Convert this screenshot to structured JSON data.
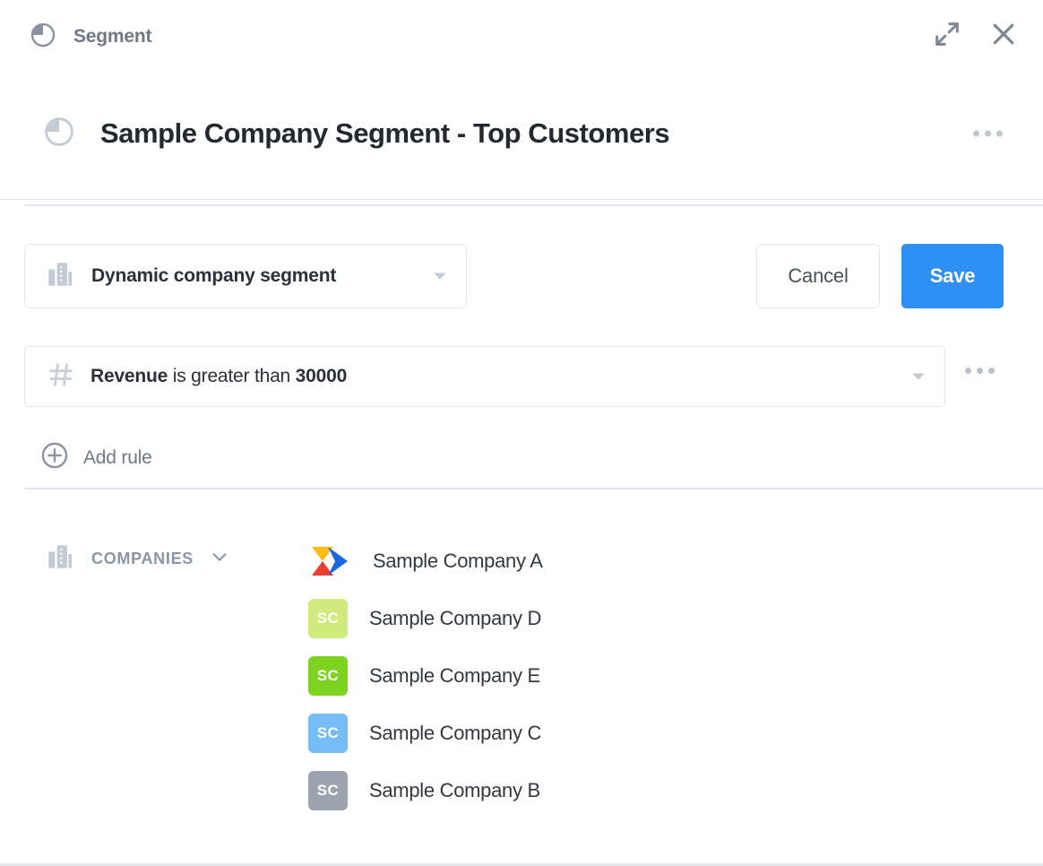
{
  "topbar": {
    "title": "Segment",
    "icon": "pie-chart-icon",
    "expand_icon": "expand-diagonal-icon",
    "close_icon": "close-icon"
  },
  "header": {
    "icon": "pie-chart-icon",
    "title": "Sample Company Segment - Top Customers",
    "overflow_icon": "more-horizontal-icon"
  },
  "toolbar": {
    "segment_type": {
      "icon": "office-building-icon",
      "label": "Dynamic company segment",
      "caret_icon": "caret-down-icon"
    },
    "cancel_label": "Cancel",
    "save_label": "Save"
  },
  "rules": {
    "rule": {
      "icon": "hash-icon",
      "field": "Revenue",
      "operator": "is greater than",
      "value": "30000",
      "caret_icon": "caret-down-icon",
      "overflow_icon": "more-horizontal-icon"
    },
    "add_rule_label": "Add rule",
    "add_rule_icon": "plus-circle-icon"
  },
  "companies_section": {
    "icon": "office-building-icon",
    "label": "COMPANIES",
    "chevron_icon": "chevron-down-icon",
    "items": [
      {
        "name": "Sample Company A",
        "avatar_type": "logo",
        "initials": "",
        "color": "#f7b500"
      },
      {
        "name": "Sample Company D",
        "avatar_type": "initials",
        "initials": "SC",
        "color": "#cfeb7d"
      },
      {
        "name": "Sample Company E",
        "avatar_type": "initials",
        "initials": "SC",
        "color": "#7ed321"
      },
      {
        "name": "Sample Company C",
        "avatar_type": "initials",
        "initials": "SC",
        "color": "#74bdf7"
      },
      {
        "name": "Sample Company B",
        "avatar_type": "initials",
        "initials": "SC",
        "color": "#9ba3ae"
      }
    ]
  },
  "colors": {
    "accent_blue": "#2e90f2",
    "text_dark": "#2b303a",
    "text_muted": "#6f7885",
    "border": "#e2e7ec"
  }
}
